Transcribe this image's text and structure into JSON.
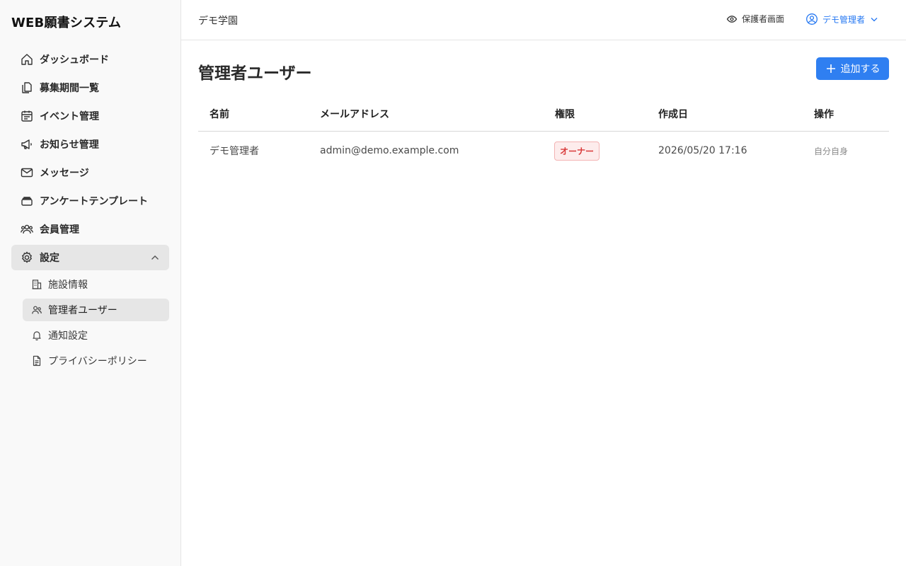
{
  "app": {
    "title": "WEB願書システム"
  },
  "sidebar": {
    "items": [
      {
        "label": "ダッシュボード",
        "icon": "home-icon"
      },
      {
        "label": "募集期間一覧",
        "icon": "documents-icon"
      },
      {
        "label": "イベント管理",
        "icon": "calendar-icon"
      },
      {
        "label": "お知らせ管理",
        "icon": "megaphone-icon"
      },
      {
        "label": "メッセージ",
        "icon": "envelope-icon"
      },
      {
        "label": "アンケートテンプレート",
        "icon": "stack-icon"
      },
      {
        "label": "会員管理",
        "icon": "users-icon"
      },
      {
        "label": "設定",
        "icon": "gear-icon",
        "expanded": true
      }
    ],
    "settings_sub": [
      {
        "label": "施設情報",
        "icon": "building-icon"
      },
      {
        "label": "管理者ユーザー",
        "icon": "users-icon",
        "active": true
      },
      {
        "label": "通知設定",
        "icon": "bell-icon"
      },
      {
        "label": "プライバシーポリシー",
        "icon": "document-icon"
      }
    ]
  },
  "header": {
    "org_name": "デモ学園",
    "guardian_view": "保護者画面",
    "user_name": "デモ管理者"
  },
  "page": {
    "title": "管理者ユーザー",
    "add_button": "追加する"
  },
  "table": {
    "columns": [
      "名前",
      "メールアドレス",
      "権限",
      "作成日",
      "操作"
    ],
    "rows": [
      {
        "name": "デモ管理者",
        "email": "admin@demo.example.com",
        "role": "オーナー",
        "created": "2026/05/20 17:16",
        "action": "自分自身"
      }
    ]
  },
  "colors": {
    "accent": "#2f7ff1",
    "user_link": "#2477f2",
    "owner_badge_text": "#d93a3a",
    "owner_badge_bg": "#fdecec"
  }
}
